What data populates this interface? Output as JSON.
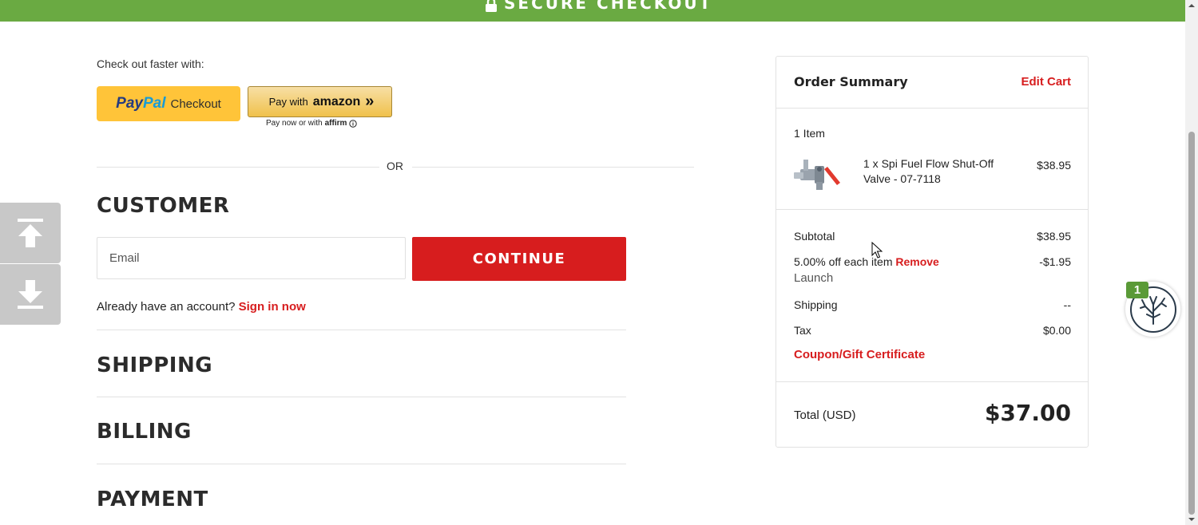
{
  "header": {
    "title": "SECURE CHECKOUT",
    "lock_icon": "lock-icon",
    "color": "#6aaa42"
  },
  "express": {
    "label": "Check out faster with:",
    "paypal": {
      "pay": "Pay",
      "pal": "Pal",
      "checkout": "Checkout"
    },
    "amazon": {
      "pay_with": "Pay with",
      "logo": "amazon",
      "arrows": "»"
    },
    "affirm": {
      "text": "Pay now or with",
      "logo": "affirm"
    },
    "or": "OR"
  },
  "customer": {
    "title": "CUSTOMER",
    "email_placeholder": "Email",
    "continue": "CONTINUE",
    "account_prompt": "Already have an account?",
    "sign_in": "Sign in now"
  },
  "sections": {
    "shipping": "SHIPPING",
    "billing": "BILLING",
    "payment": "PAYMENT"
  },
  "side_nav": {
    "up_icon": "arrow-up-icon",
    "down_icon": "arrow-down-icon"
  },
  "summary": {
    "title": "Order Summary",
    "edit_cart": "Edit Cart",
    "items_count": "1 Item",
    "product": {
      "name": "1 x Spi Fuel Flow Shut-Off Valve - 07-7118",
      "price": "$38.95"
    },
    "subtotal": {
      "label": "Subtotal",
      "value": "$38.95"
    },
    "discount": {
      "label": "5.00% off each item",
      "remove": "Remove",
      "name": "Launch",
      "value": "-$1.95"
    },
    "shipping": {
      "label": "Shipping",
      "value": "--"
    },
    "tax": {
      "label": "Tax",
      "value": "$0.00"
    },
    "coupon": "Coupon/Gift Certificate",
    "total": {
      "label": "Total (USD)",
      "value": "$37.00"
    }
  },
  "widget": {
    "badge": "1",
    "icon": "tree-icon"
  },
  "colors": {
    "accent": "#d71d1e",
    "header": "#6aaa42",
    "paypal": "#ffc439"
  }
}
